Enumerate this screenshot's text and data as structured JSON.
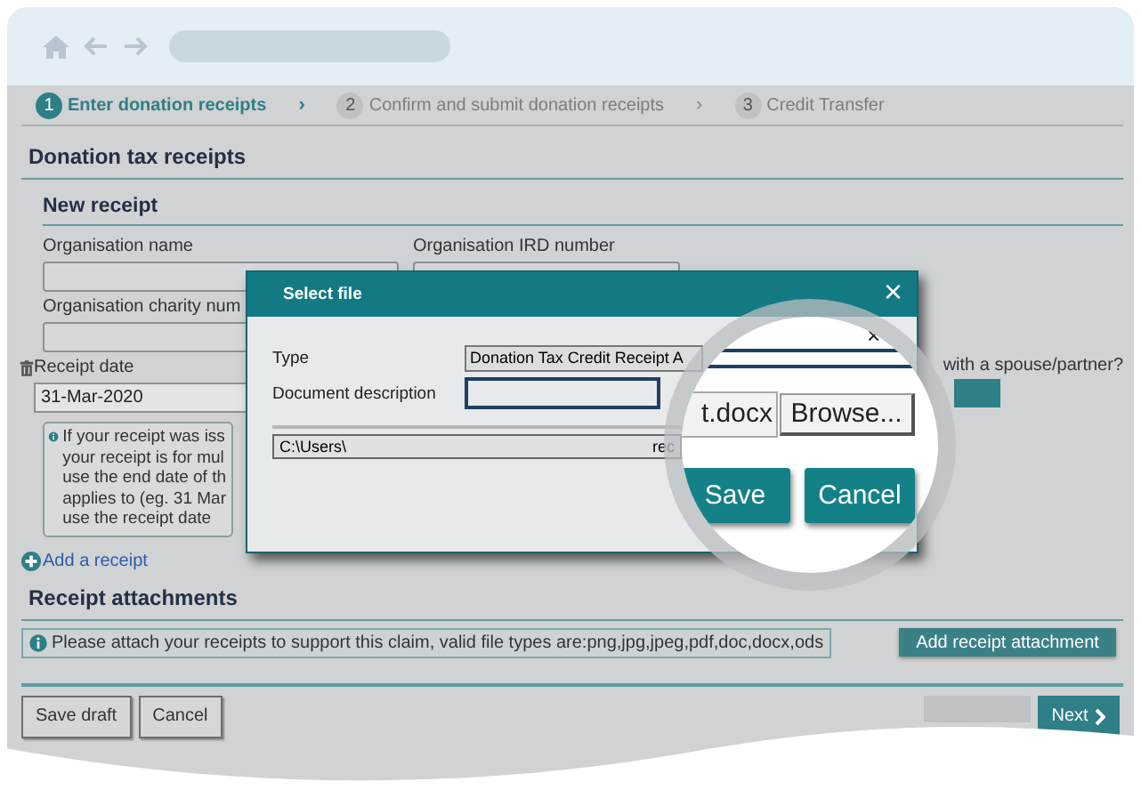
{
  "steps": [
    {
      "number": "1",
      "label": "Enter donation receipts",
      "selected": true
    },
    {
      "number": "2",
      "label": "Confirm and submit donation receipts",
      "selected": false
    },
    {
      "number": "3",
      "label": "Credit Transfer",
      "selected": false
    }
  ],
  "step_separators": [
    "›",
    "›"
  ],
  "page": {
    "title": "Donation tax receipts",
    "new_receipt": {
      "title": "New receipt",
      "fields": [
        {
          "label": "Organisation name"
        },
        {
          "label": "Organisation IRD number"
        },
        {
          "label": "Organisation charity num"
        }
      ],
      "receipt_date": {
        "label": "Receipt date",
        "value": "31-Mar-2020"
      },
      "info_lines": [
        "If your receipt was iss",
        "your receipt is for mul",
        "use the end date of th",
        "applies to (eg. 31 Mar",
        "use the receipt date"
      ],
      "spouse_question": "with a spouse/partner?"
    },
    "add_receipt": "Add a receipt",
    "attachments": {
      "title": "Receipt attachments",
      "info": "Please attach your receipts to support this claim, valid file types are:png,jpg,jpeg,pdf,doc,docx,ods",
      "button": "Add receipt attachment"
    },
    "footer": {
      "buttons": [
        "Save draft",
        "Cancel"
      ],
      "previous": {
        "disabled": true
      },
      "next": "Next"
    }
  },
  "dialog": {
    "title": "Select file",
    "close": "×",
    "type_label": "Type",
    "type_value": "Donation Tax Credit Receipt A",
    "description_label": "Document description",
    "path_start": "C:\\Users\\",
    "path_end": "rec"
  },
  "magnifier": {
    "close": "×",
    "file_name": "t.docx",
    "browse": "Browse...",
    "buttons": [
      "Save",
      "Cancel"
    ]
  }
}
